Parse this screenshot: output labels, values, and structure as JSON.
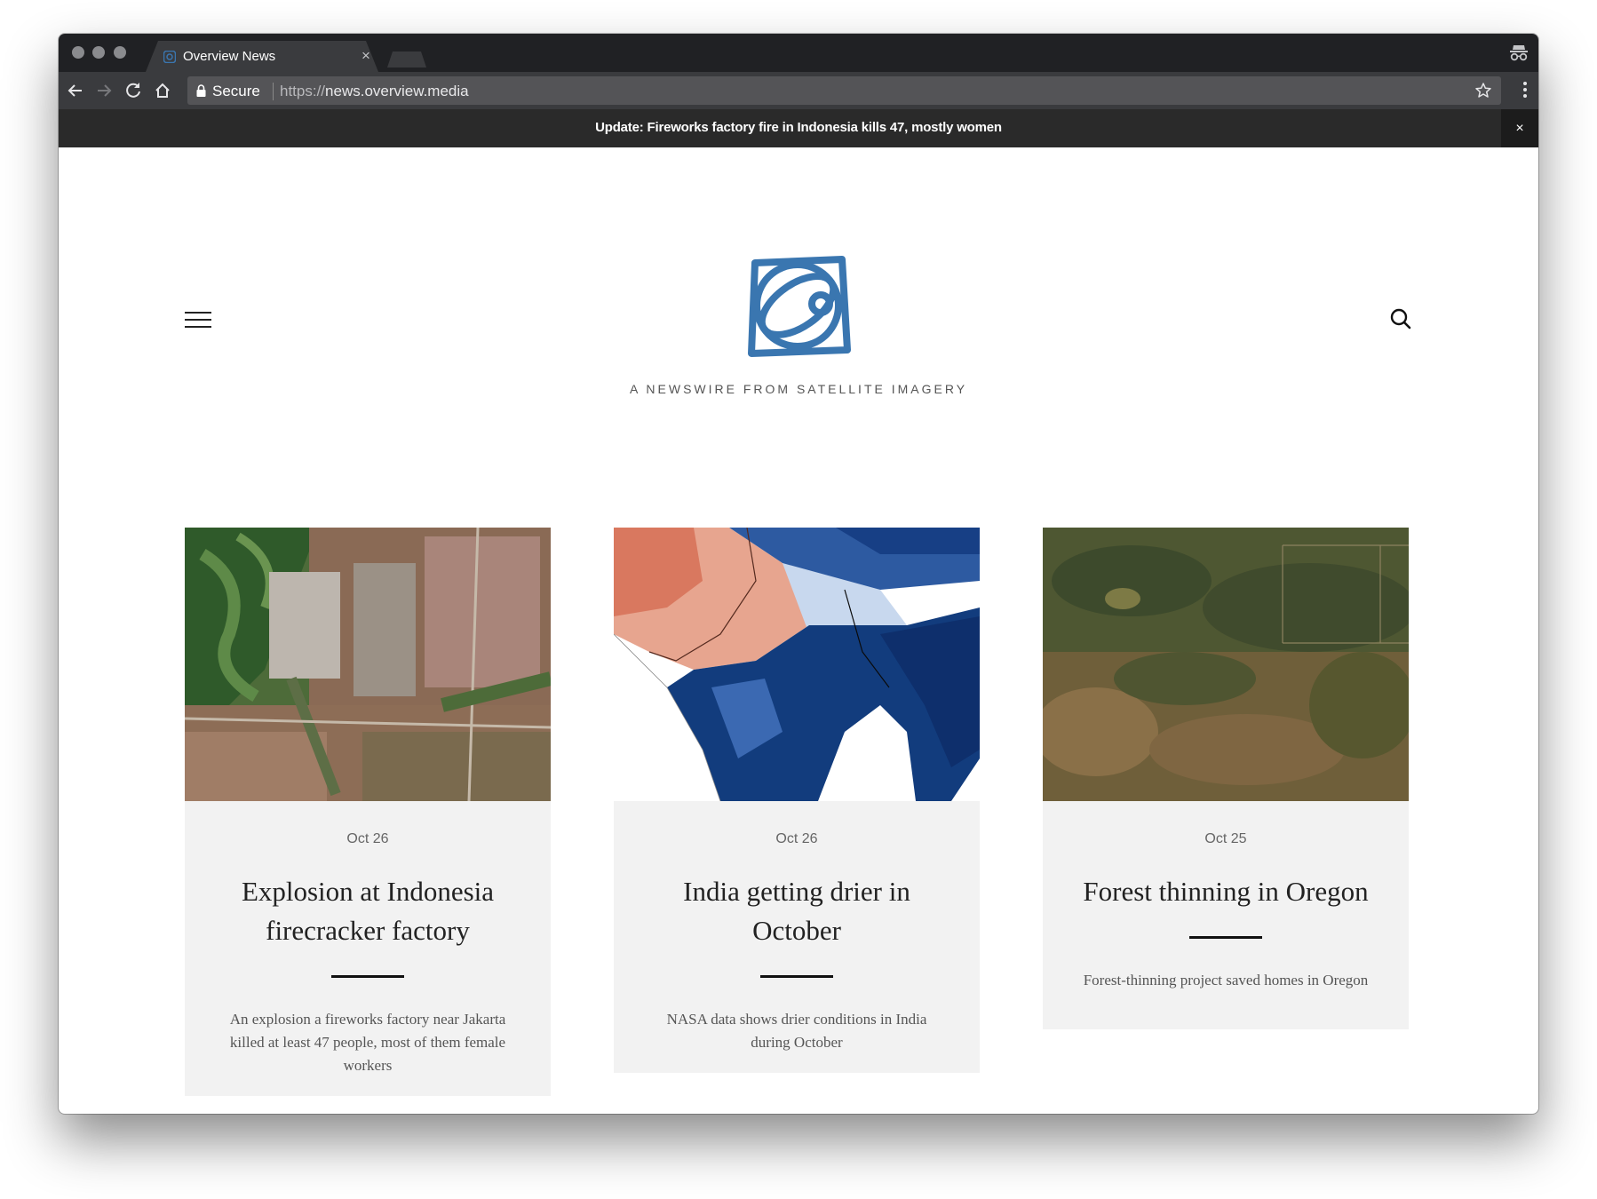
{
  "browser": {
    "tab_title": "Overview News",
    "tab_close": "×",
    "secure_label": "Secure",
    "url_scheme": "https://",
    "url_host": "news.overview.media"
  },
  "alert": {
    "text": "Update: Fireworks factory fire in Indonesia kills 47, mostly women",
    "close": "×"
  },
  "site": {
    "tagline": "A NEWSWIRE FROM SATELLITE IMAGERY",
    "brand_color": "#3a76b0"
  },
  "cards": [
    {
      "date": "Oct 26",
      "title": "Explosion at Indonesia firecracker factory",
      "description": "An explosion a fireworks factory near Jakarta killed at least 47 people, most of them female workers",
      "image": "satellite-image-jakarta-suburbs"
    },
    {
      "date": "Oct 26",
      "title": "India getting drier in October",
      "description": "NASA data shows drier conditions in India during October",
      "image": "moisture-map-india"
    },
    {
      "date": "Oct 25",
      "title": "Forest thinning in Oregon",
      "description": "Forest-thinning project saved homes in Oregon",
      "image": "satellite-image-oregon-forest"
    }
  ]
}
